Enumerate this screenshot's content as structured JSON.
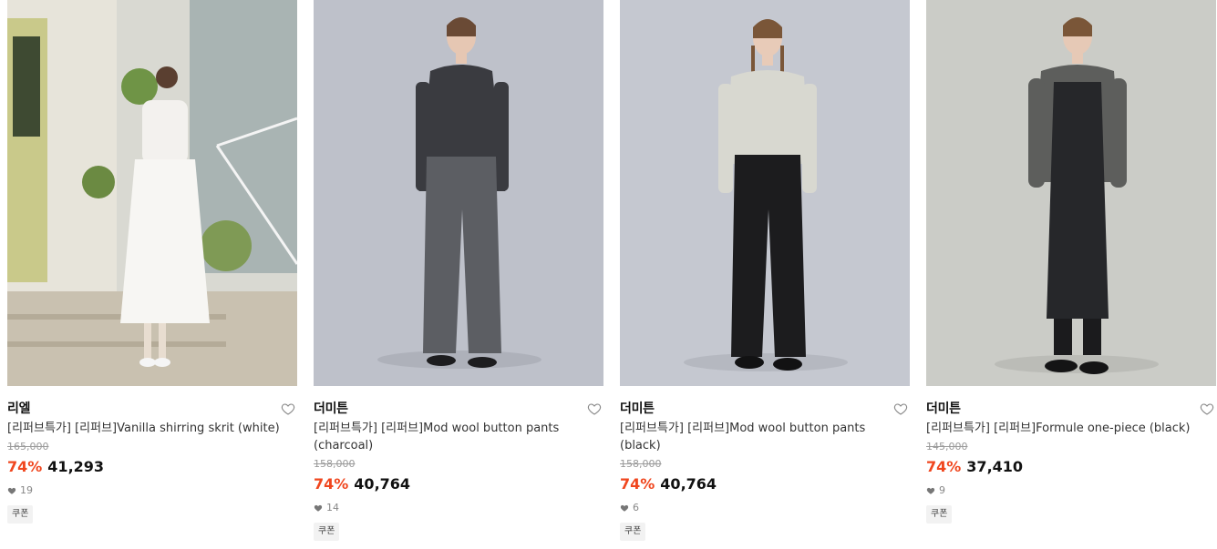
{
  "products": [
    {
      "brand": "리엘",
      "title": "[리퍼브특가] [리퍼브]Vanilla shirring skrit (white)",
      "original_price": "165,000",
      "discount": "74%",
      "price": "41,293",
      "likes": "19",
      "coupon": "쿠폰",
      "photo_colors": {
        "bg": "#cfd3cf",
        "top": "#f3f1ee",
        "bottom": "#f7f6f3"
      }
    },
    {
      "brand": "더미튼",
      "title": "[리퍼브특가] [리퍼브]Mod wool button pants (charcoal)",
      "original_price": "158,000",
      "discount": "74%",
      "price": "40,764",
      "likes": "14",
      "coupon": "쿠폰",
      "photo_colors": {
        "bg": "#bcbfc8",
        "top": "#3a3b40",
        "bottom": "#5c5e63"
      }
    },
    {
      "brand": "더미튼",
      "title": "[리퍼브특가] [리퍼브]Mod wool button pants (black)",
      "original_price": "158,000",
      "discount": "74%",
      "price": "40,764",
      "likes": "6",
      "coupon": "쿠폰",
      "photo_colors": {
        "bg": "#c3c6cf",
        "top": "#d8d8d0",
        "bottom": "#1c1c1e"
      }
    },
    {
      "brand": "더미튼",
      "title": "[리퍼브특가] [리퍼브]Formule one-piece (black)",
      "original_price": "145,000",
      "discount": "74%",
      "price": "37,410",
      "likes": "9",
      "coupon": "쿠폰",
      "photo_colors": {
        "bg": "#c9cac5",
        "top": "#5d5e5c",
        "bottom": "#26272a"
      }
    }
  ],
  "colors": {
    "discount": "#f0461e",
    "muted": "#9a9a9a"
  }
}
